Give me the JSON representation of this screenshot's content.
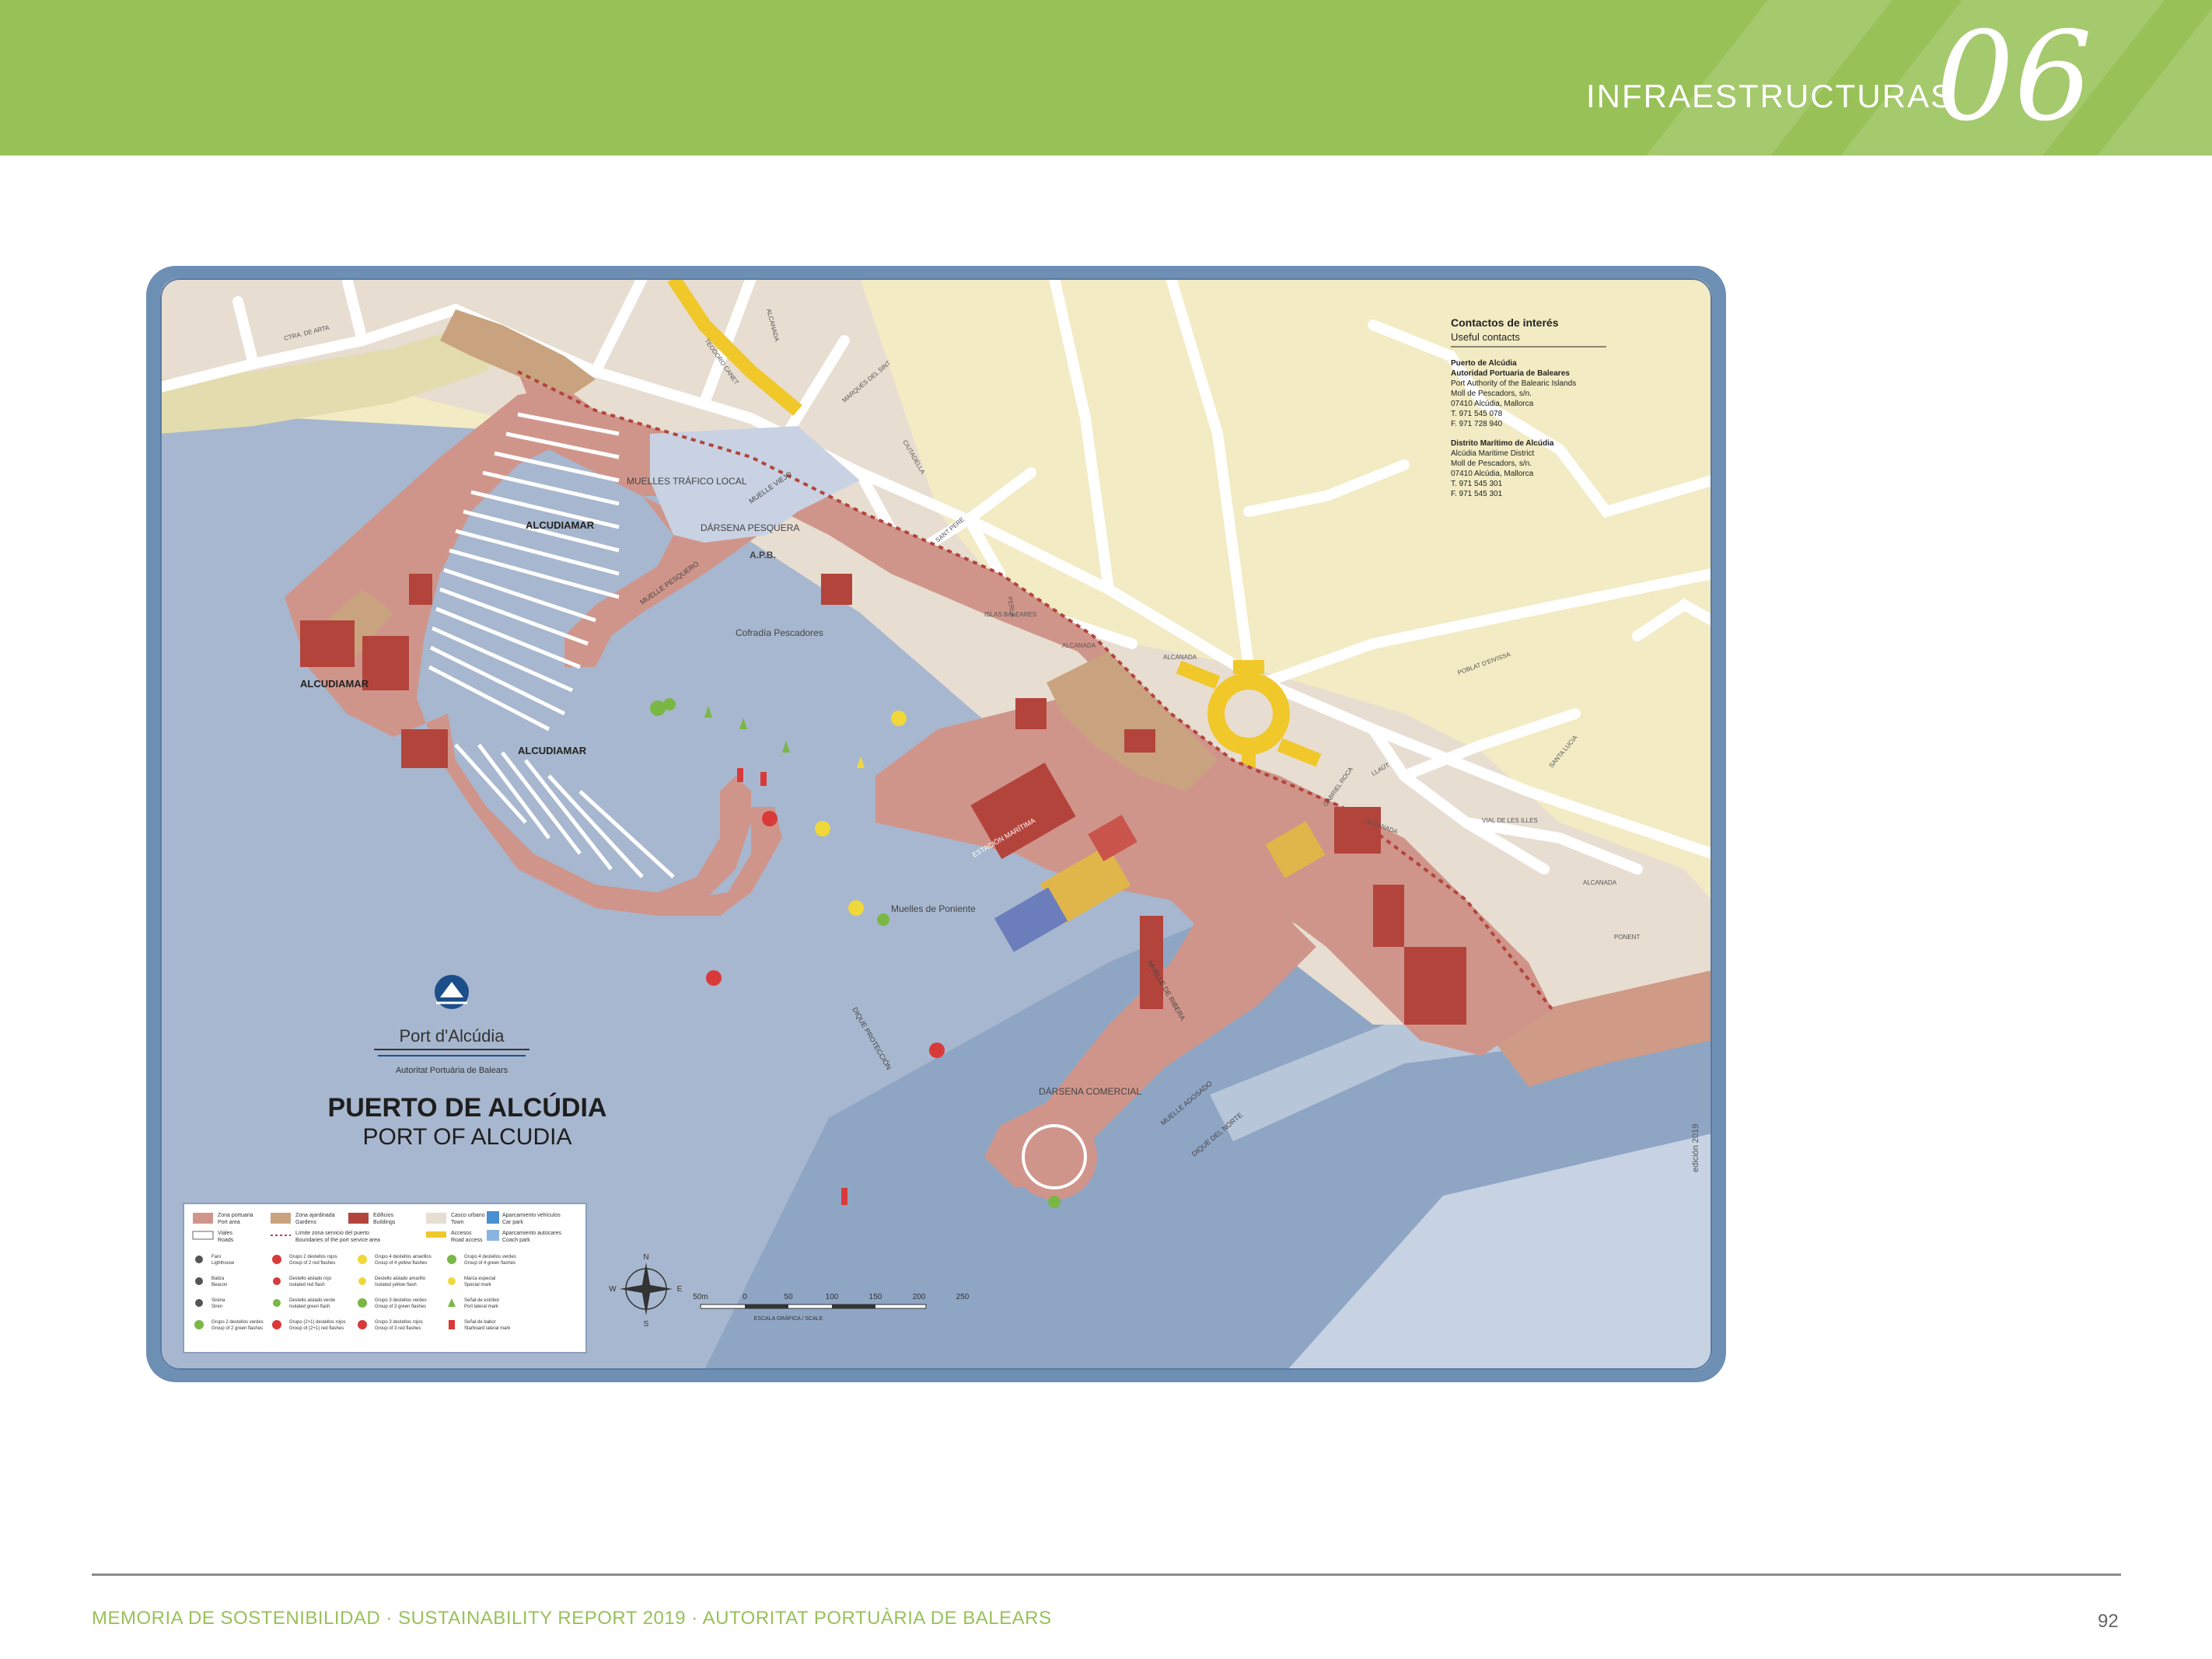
{
  "header": {
    "section_label": "INFRAESTRUCTURAS",
    "section_number": "06"
  },
  "colors": {
    "banner": "#98c158",
    "water": "#a7b7cf",
    "deep_water": "#8fa5c4",
    "port_zone": "#d0958a",
    "buildings": "#b3443c",
    "town": "#e7ddd1",
    "land": "#f2ebc3",
    "access_road": "#f0c82a",
    "footer_accent": "#98c158"
  },
  "map": {
    "title": "PUERTO DE ALCÚDIA",
    "subtitle": "PORT OF ALCUDIA",
    "logo_name": "Port d'Alcúdia",
    "logo_authority": "Autoritat Portuària de Balears",
    "edition": "edición 2019",
    "area_labels": [
      "ALCUDIAMAR",
      "ALCUDIAMAR",
      "ALCUDIAMAR",
      "DÁRSENA PESQUERA",
      "MUELLES TRÁFICO LOCAL",
      "Cofradía Pescadores",
      "A.P.B.",
      "Muelles de Poniente",
      "DÁRSENA COMERCIAL",
      "ESTACIÓN MARÍTIMA",
      "MUELLE DE RIBERA",
      "MUELLE ADOSADO",
      "MUELLE PESQUERO",
      "MUELLE VIEJO",
      "DIQUE DEL NORTE",
      "DIQUE PROTECCIÓN"
    ],
    "street_labels": [
      "CTRA. DE ARTA",
      "TEODORO CANET",
      "ALCANADA",
      "MARQUÉS DEL SINT",
      "CIUTADELLA",
      "SANT PERE",
      "PERLA",
      "ISLAS BALEARES",
      "ALCANADA",
      "ALCANADA",
      "LLAÜT",
      "GABRIEL ROCA",
      "ALCANADA",
      "VIAL DE LES ILLES",
      "PONENT",
      "POBLAT D'EIVISSA",
      "SANTA LUCIA",
      "ALCANADA"
    ],
    "contacts": {
      "heading": "Contactos de interés",
      "heading_en": "Useful contacts",
      "entries": [
        {
          "name": "Puerto de Alcúdia",
          "org": "Autoridad Portuaria de Baleares",
          "lines": [
            "Port Authority of the Balearic Islands",
            "Moll de Pescadors, s/n.",
            "07410 Alcúdia, Mallorca",
            "T. 971 545 078",
            "F. 971 728 940"
          ]
        },
        {
          "name": "Distrito Marítimo de Alcúdia",
          "org": "Alcúdia Maritime District",
          "lines": [
            "Moll de Pescadors, s/n.",
            "07410 Alcúdia, Mallorca",
            "T. 971 545 301",
            "F. 971 545 301"
          ]
        }
      ]
    },
    "legend": {
      "row1": [
        {
          "icon": "port-zone",
          "es": "Zona portuaria",
          "en": "Port area"
        },
        {
          "icon": "green-area",
          "es": "Zona ajardinada",
          "en": "Gardens"
        },
        {
          "icon": "building",
          "es": "Edificios",
          "en": "Buildings"
        },
        {
          "icon": "town",
          "es": "Casco urbano",
          "en": "Town"
        },
        {
          "icon": "parking",
          "es": "Aparcamiento vehículos",
          "en": "Car park"
        }
      ],
      "row2": [
        {
          "icon": "road",
          "es": "Viales",
          "en": "Roads"
        },
        {
          "icon": "limit",
          "es": "Límite zona servicio del puerto",
          "en": "Boundaries of the port service area"
        },
        {
          "icon": "access",
          "es": "Accesos",
          "en": "Road access"
        },
        {
          "icon": "coach",
          "es": "Aparcamiento autocares",
          "en": "Coach park"
        }
      ],
      "buoys": [
        {
          "icon": "lighthouse",
          "es": "Faro",
          "en": "Lighthouse"
        },
        {
          "icon": "beacon",
          "es": "Baliza",
          "en": "Beacon"
        },
        {
          "icon": "siren",
          "es": "Sirena",
          "en": "Siren"
        },
        {
          "icon": "green-group",
          "es": "Grupo 2 destellos verdes",
          "en": "Group of 2 green flashes"
        },
        {
          "icon": "red-group-2",
          "es": "Grupo 2 destellos rojos",
          "en": "Group of 2 red flashes"
        },
        {
          "icon": "red-isolated",
          "es": "Destello aislado rojo",
          "en": "Isolated red flash"
        },
        {
          "icon": "green-isolated",
          "es": "Destello aislado verde",
          "en": "Isolated green flash"
        },
        {
          "icon": "red-group-4",
          "es": "Grupo (2+1) destellos rojos",
          "en": "Group of (2+1) red flashes"
        },
        {
          "icon": "yellow-group-4",
          "es": "Grupo 4 destellos amarillos",
          "en": "Group of 4 yellow flashes"
        },
        {
          "icon": "yellow-isolated",
          "es": "Destello aislado amarillo",
          "en": "Isolated yellow flash"
        },
        {
          "icon": "green-group-3",
          "es": "Grupo 3 destellos verdes",
          "en": "Group of 3 green flashes"
        },
        {
          "icon": "red-group-3",
          "es": "Grupo 3 destellos rojos",
          "en": "Group of 3 red flashes"
        },
        {
          "icon": "green-group-4",
          "es": "Grupo 4 destellos verdes",
          "en": "Group of 4 green flashes"
        },
        {
          "icon": "special",
          "es": "Marca especial",
          "en": "Special mark"
        },
        {
          "icon": "starboard",
          "es": "Señal de estribor",
          "en": "Port lateral mark"
        },
        {
          "icon": "port",
          "es": "Señal de babor",
          "en": "Starboard lateral mark"
        }
      ]
    },
    "scale": {
      "ticks": [
        "50m",
        "0",
        "50",
        "100",
        "150",
        "200",
        "250"
      ],
      "label": "ESCALA GRÁFICA / SCALE"
    },
    "compass": [
      "N",
      "S",
      "E",
      "W"
    ]
  },
  "footer": {
    "part1": "MEMORIA DE SOSTENIBILIDAD · SUSTAINABILITY REPORT 2019 · ",
    "part2": "AUTORITAT PORTUÀRIA DE BALEARS",
    "page": "92"
  }
}
